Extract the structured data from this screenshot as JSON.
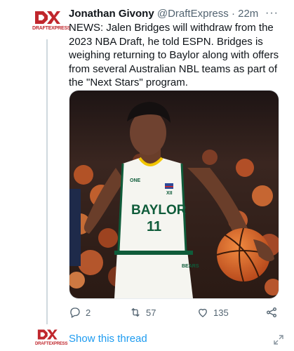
{
  "tweet": {
    "author_name": "Jonathan Givony",
    "author_handle": "@DraftExpress",
    "separator": "·",
    "time": "22m",
    "more_label": "···",
    "text": "NEWS: Jalen Bridges will withdraw from the 2023 NBA Draft, he told ESPN. Bridges is weighing returning to Baylor along with offers from several Australian NBL teams as part of the \"Next Stars\" program.",
    "avatar_brand": "DRAFTEXPRESS",
    "media": {
      "jersey_team": "BAYLOR",
      "jersey_number": "11",
      "jersey_patch": "ONE",
      "jersey_hem": "BEARS",
      "conference_logo": "XII"
    },
    "actions": {
      "replies": "2",
      "retweets": "57",
      "likes": "135"
    }
  },
  "show_thread_label": "Show this thread",
  "colors": {
    "brand_red": "#c0272d",
    "link_blue": "#1d9bf0",
    "muted": "#536471",
    "jersey_green": "#0f5c3a",
    "jersey_gold": "#f2c500",
    "court_orange": "#e06020"
  },
  "icons": [
    "more-icon",
    "reply-icon",
    "retweet-icon",
    "like-icon",
    "share-icon",
    "expand-icon"
  ]
}
